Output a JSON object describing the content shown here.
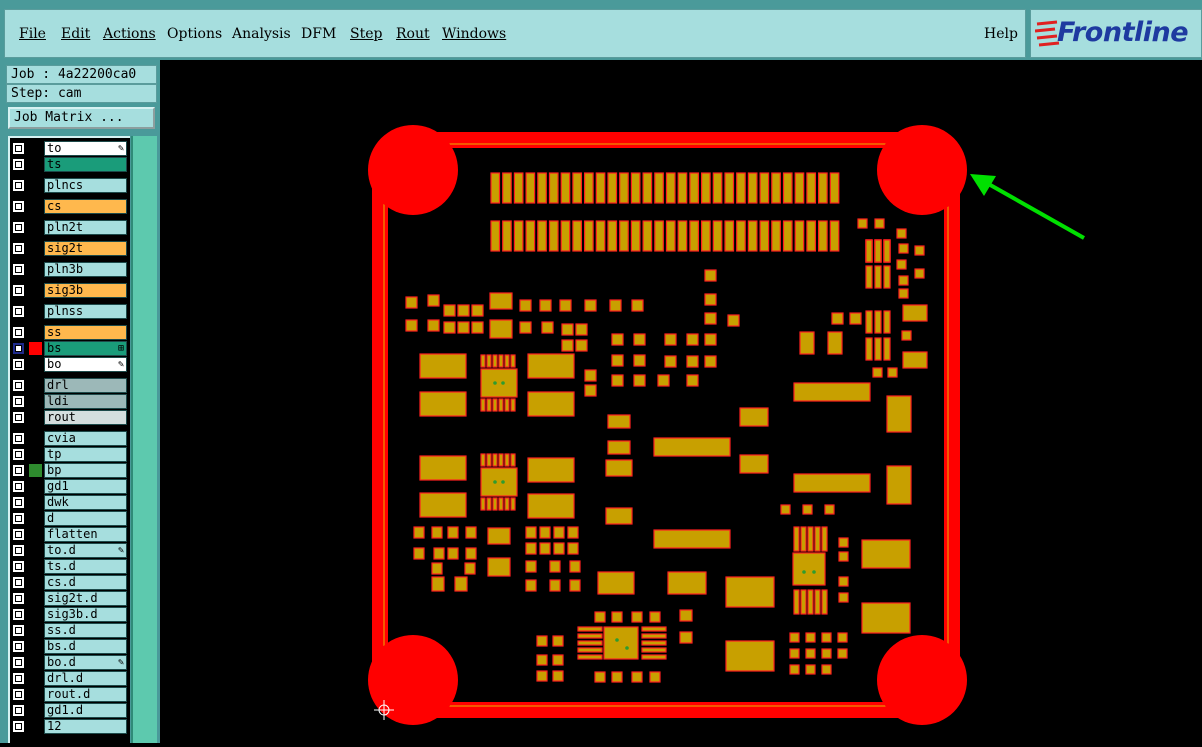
{
  "menu": {
    "file": "File",
    "edit": "Edit",
    "actions": "Actions",
    "options": "Options",
    "analysis": "Analysis",
    "dfm": "DFM",
    "step": "Step",
    "rout": "Rout",
    "windows": "Windows",
    "help": "Help"
  },
  "logo": "Frontline",
  "job_label": "Job : 4a22200ca0",
  "step_label": "Step: cam",
  "job_matrix": "Job Matrix ...",
  "layers": [
    {
      "name": "to",
      "bg": "#ffffff",
      "mark": "edit-icon",
      "group": 0
    },
    {
      "name": "ts",
      "bg": "#1a9c7a",
      "group": 0
    },
    {
      "name": "plncs",
      "bg": "#a6dede",
      "group": 1
    },
    {
      "name": "cs",
      "bg": "#ffb84d",
      "group": 2
    },
    {
      "name": "pln2t",
      "bg": "#a6dede",
      "group": 3
    },
    {
      "name": "sig2t",
      "bg": "#ffb84d",
      "group": 4
    },
    {
      "name": "pln3b",
      "bg": "#a6dede",
      "group": 5
    },
    {
      "name": "sig3b",
      "bg": "#ffb84d",
      "group": 6
    },
    {
      "name": "plnss",
      "bg": "#a6dede",
      "group": 7
    },
    {
      "name": "ss",
      "bg": "#ffb84d",
      "group": 8
    },
    {
      "name": "bs",
      "bg": "#1a9c7a",
      "color": "#ff0000",
      "active": true,
      "mark": "dots-icon",
      "group": 8
    },
    {
      "name": "bo",
      "bg": "#ffffff",
      "mark": "edit-icon",
      "group": 8
    },
    {
      "name": "drl",
      "bg": "#9cb8b8",
      "group": 9
    },
    {
      "name": "ldi",
      "bg": "#9cb8b8",
      "group": 9
    },
    {
      "name": "rout",
      "bg": "#d4dede",
      "group": 9
    },
    {
      "name": "cvia",
      "bg": "#a6dede",
      "group": 10
    },
    {
      "name": "tp",
      "bg": "#a6dede",
      "group": 10
    },
    {
      "name": "bp",
      "bg": "#a6dede",
      "color": "#2e8b2e",
      "group": 10
    },
    {
      "name": "gd1",
      "bg": "#a6dede",
      "group": 10
    },
    {
      "name": "dwk",
      "bg": "#a6dede",
      "group": 10
    },
    {
      "name": "d",
      "bg": "#a6dede",
      "group": 10
    },
    {
      "name": "flatten",
      "bg": "#a6dede",
      "group": 10
    },
    {
      "name": "to.d",
      "bg": "#a6dede",
      "mark": "edit-icon",
      "group": 10
    },
    {
      "name": "ts.d",
      "bg": "#a6dede",
      "group": 10
    },
    {
      "name": "cs.d",
      "bg": "#a6dede",
      "group": 10
    },
    {
      "name": "sig2t.d",
      "bg": "#a6dede",
      "group": 10
    },
    {
      "name": "sig3b.d",
      "bg": "#a6dede",
      "group": 10
    },
    {
      "name": "ss.d",
      "bg": "#a6dede",
      "group": 10
    },
    {
      "name": "bs.d",
      "bg": "#a6dede",
      "group": 10
    },
    {
      "name": "bo.d",
      "bg": "#a6dede",
      "mark": "edit-icon",
      "group": 10
    },
    {
      "name": "drl.d",
      "bg": "#a6dede",
      "group": 10
    },
    {
      "name": "rout.d",
      "bg": "#a6dede",
      "group": 10
    },
    {
      "name": "gd1.d",
      "bg": "#a6dede",
      "group": 10
    },
    {
      "name": "12",
      "bg": "#a6dede",
      "group": 10
    }
  ],
  "colors": {
    "board_outline": "#ff0000",
    "pad_fill": "#c8a000",
    "pad_edge": "#ff2020",
    "via_green": "#2e9c2e",
    "arrow": "#00e000"
  },
  "cursor_icon": "crosshair-icon"
}
